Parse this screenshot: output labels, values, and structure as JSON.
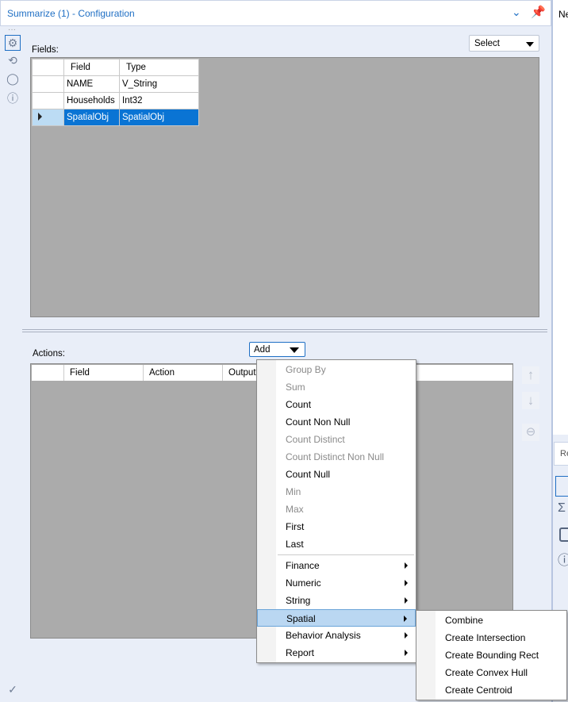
{
  "header": {
    "title": "Summarize (1) - Configuration"
  },
  "right_panel": {
    "top_text": "Ne",
    "lower_tab": "Re"
  },
  "fields": {
    "label": "Fields:",
    "select_label": "Select",
    "columns": [
      "Field",
      "Type"
    ],
    "rows": [
      {
        "field": "NAME",
        "type": "V_String"
      },
      {
        "field": "Households",
        "type": "Int32"
      },
      {
        "field": "SpatialObj",
        "type": "SpatialObj",
        "selected": true
      }
    ]
  },
  "actions": {
    "label": "Actions:",
    "add_label": "Add",
    "columns": [
      "Field",
      "Action",
      "Output"
    ]
  },
  "menu": {
    "items": [
      {
        "label": "Group By",
        "enabled": false
      },
      {
        "label": "Sum",
        "enabled": false
      },
      {
        "label": "Count",
        "enabled": true
      },
      {
        "label": "Count Non Null",
        "enabled": true
      },
      {
        "label": "Count Distinct",
        "enabled": false
      },
      {
        "label": "Count Distinct Non Null",
        "enabled": false
      },
      {
        "label": "Count Null",
        "enabled": true
      },
      {
        "label": "Min",
        "enabled": false
      },
      {
        "label": "Max",
        "enabled": false
      },
      {
        "label": "First",
        "enabled": true
      },
      {
        "label": "Last",
        "enabled": true
      }
    ],
    "submenus": [
      {
        "label": "Finance"
      },
      {
        "label": "Numeric"
      },
      {
        "label": "String"
      },
      {
        "label": "Spatial",
        "highlighted": true
      },
      {
        "label": "Behavior Analysis"
      },
      {
        "label": "Report"
      }
    ]
  },
  "spatial_submenu": [
    "Combine",
    "Create Intersection",
    "Create Bounding Rect",
    "Create Convex Hull",
    "Create Centroid"
  ],
  "colors": {
    "accent": "#0a74d4",
    "title": "#1f6fc4",
    "grid_bg": "#ababab",
    "panel_bg": "#e9eef8"
  }
}
